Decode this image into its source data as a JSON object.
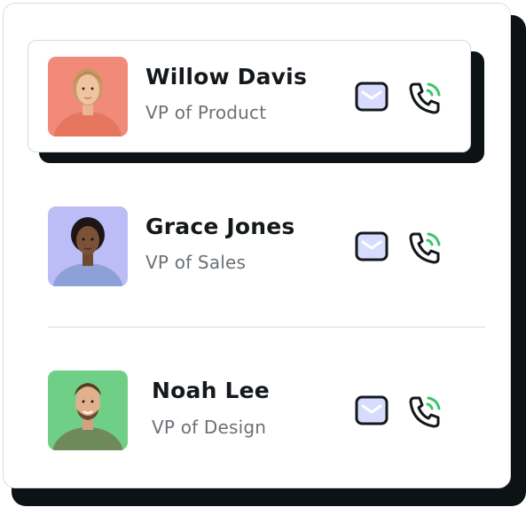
{
  "colors": {
    "shadow": "#0d1214",
    "name_text": "#15191c",
    "role_text": "#6b7176",
    "mail_fill": "#d7dcff",
    "call_accent": "#3ec46d",
    "avatar_bg_willow": "#f28a7a",
    "avatar_bg_grace": "#bcbcf7",
    "avatar_bg_noah": "#6fcf86"
  },
  "contacts": [
    {
      "name": "Willow Davis",
      "role": "VP of Product",
      "icons": [
        "mail-icon",
        "phone-call-icon"
      ]
    },
    {
      "name": "Grace Jones",
      "role": "VP of Sales",
      "icons": [
        "mail-icon",
        "phone-call-icon"
      ]
    },
    {
      "name": "Noah Lee",
      "role": "VP of Design",
      "icons": [
        "mail-icon",
        "phone-call-icon"
      ]
    }
  ]
}
